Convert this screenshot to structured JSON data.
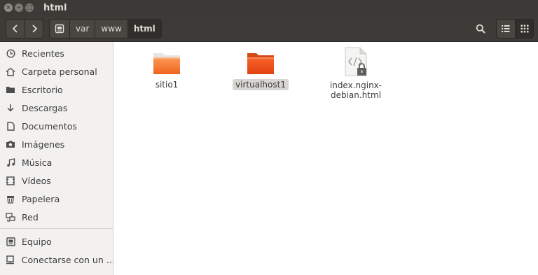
{
  "window": {
    "title": "html",
    "buttons": {
      "close": "×",
      "minimize": "–",
      "maximize": "□"
    }
  },
  "toolbar": {
    "back": "‹",
    "forward": "›",
    "path": [
      "var",
      "www",
      "html"
    ]
  },
  "sidebar": {
    "items": [
      {
        "label": "Recientes",
        "icon": "clock-icon"
      },
      {
        "label": "Carpeta personal",
        "icon": "home-icon"
      },
      {
        "label": "Escritorio",
        "icon": "folder-icon"
      },
      {
        "label": "Descargas",
        "icon": "download-icon"
      },
      {
        "label": "Documentos",
        "icon": "document-icon"
      },
      {
        "label": "Imágenes",
        "icon": "camera-icon"
      },
      {
        "label": "Música",
        "icon": "music-icon"
      },
      {
        "label": "Vídeos",
        "icon": "video-icon"
      },
      {
        "label": "Papelera",
        "icon": "trash-icon"
      },
      {
        "label": "Red",
        "icon": "network-icon"
      },
      {
        "label": "Equipo",
        "icon": "computer-icon"
      },
      {
        "label": "Conectarse con un …",
        "icon": "server-icon"
      }
    ]
  },
  "files": [
    {
      "name": "sitio1",
      "type": "folder",
      "selected": false
    },
    {
      "name": "virtualhost1",
      "type": "folder",
      "selected": true
    },
    {
      "name_line1": "index.nginx-",
      "name_line2": "debian.html",
      "type": "html-file-locked"
    }
  ],
  "colors": {
    "folder_light": "#f9843f",
    "folder_selected": "#f05a1f",
    "header": "#3c3b37",
    "sidebar": "#f2f1f0"
  }
}
